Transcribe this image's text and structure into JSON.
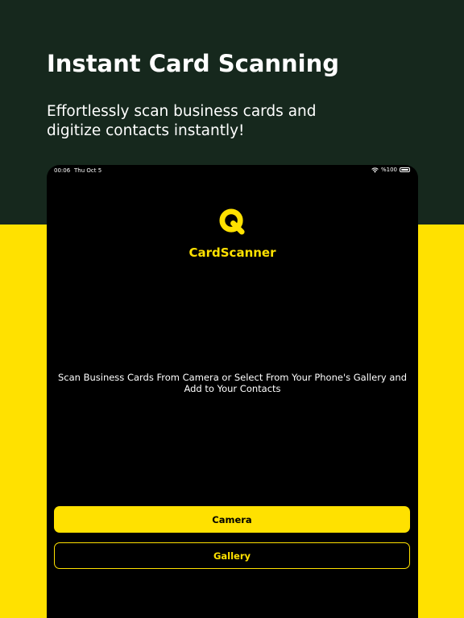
{
  "promo": {
    "headline": "Instant Card Scanning",
    "subline": "Effortlessly scan business cards and digitize contacts instantly!"
  },
  "status_bar": {
    "time": "00:06",
    "date": "Thu Oct 5",
    "battery": "%100",
    "icons": [
      "wifi-icon",
      "battery-icon"
    ]
  },
  "app": {
    "name": "CardScanner",
    "logo_icon": "q-logo-icon",
    "description": "Scan Business Cards From Camera or Select From Your Phone's Gallery and Add to Your Contacts",
    "camera_label": "Camera",
    "gallery_label": "Gallery"
  },
  "colors": {
    "accent": "#ffe100",
    "dark_green": "#16281d",
    "screen_bg": "#000000"
  }
}
